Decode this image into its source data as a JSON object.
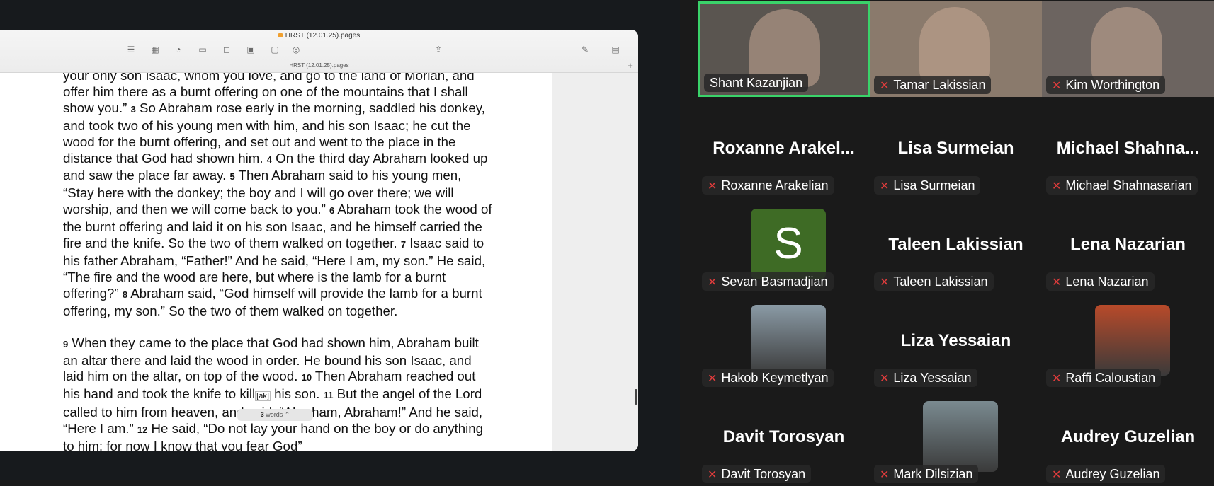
{
  "pages_window": {
    "title": "HRST (12.01.25).pages",
    "subtitle": "HRST (12.01.25).pages",
    "toolbar_icons": [
      "list-icon",
      "table-icon",
      "chart-icon",
      "text-icon",
      "shape-icon",
      "media-icon",
      "comment-icon",
      "collaborate-icon",
      "share-icon",
      "format-brush-icon",
      "document-icon"
    ],
    "word_count_number": "3",
    "word_count_label": " words ⌃",
    "document_paragraphs": [
      [
        {
          "t": "your only son Isaac, whom you love, and go to the land of Moriah, and offer him there as a burnt offering on one of the mountains that I shall show you.” "
        },
        {
          "v": "3"
        },
        {
          "t": " So Abraham rose early in the morning, saddled his donkey, and took two of his young men with him, and his son Isaac; he cut the wood for the burnt offering, and set out and went to the place in the distance that God had shown him. "
        },
        {
          "v": "4"
        },
        {
          "t": " On the third day Abraham looked up and saw the place far away. "
        },
        {
          "v": "5"
        },
        {
          "t": " Then Abraham said to his young men, “Stay here with the donkey; the boy and I will go over there; we will worship, and then we will come back to you.” "
        },
        {
          "v": "6"
        },
        {
          "t": " Abraham took the wood of the burnt offering and laid it on his son Isaac, and he himself carried the fire and the knife. So the two of them walked on together. "
        },
        {
          "v": "7"
        },
        {
          "t": " Isaac said to his father Abraham, “Father!” And he said, “Here I am, my son.” He said, “The fire and the wood are here, but where is the lamb for a burnt offering?” "
        },
        {
          "v": "8"
        },
        {
          "t": " Abraham said, “God himself will provide the lamb for a burnt offering, my son.” So the two of them walked on together."
        }
      ],
      [
        {
          "v": "9"
        },
        {
          "t": " When they came to the place that God had shown him, Abraham built an altar there and laid the wood in order. He bound his son Isaac, and laid him on the altar, on top of the wood. "
        },
        {
          "v": "10"
        },
        {
          "t": " Then Abraham reached out his hand and took the knife to kill"
        },
        {
          "f": "[ak]"
        },
        {
          "t": " his son. "
        },
        {
          "v": "11"
        },
        {
          "t": " But the angel of the Lord called to him from heaven, and said, “Abraham, Abraham!” And he said, “Here I am.” "
        },
        {
          "v": "12"
        },
        {
          "t": " He said, “Do not lay your hand on the boy or do anything to him; for now I know that you fear God”"
        }
      ]
    ]
  },
  "participants": [
    {
      "name": "Shant Kazanjian",
      "display": "Shant Kazanjian",
      "type": "video",
      "muted": false,
      "active": true,
      "bg": "#5a5550"
    },
    {
      "name": "Tamar Lakissian",
      "display": "Tamar Lakissian",
      "type": "video",
      "muted": true,
      "bg": "#8a7a6c"
    },
    {
      "name": "Kim Worthington",
      "display": "Kim Worthington",
      "type": "video",
      "muted": true,
      "bg": "#6c6460"
    },
    {
      "name": "Roxanne Arakelian",
      "display": "Roxanne  Arakel...",
      "type": "name",
      "muted": true
    },
    {
      "name": "Lisa Surmeian",
      "display": "Lisa Surmeian",
      "type": "name",
      "muted": true
    },
    {
      "name": "Michael Shahnasarian",
      "display": "Michael  Shahna...",
      "type": "name",
      "muted": true
    },
    {
      "name": "Sevan Basmadjian",
      "display": "S",
      "type": "letter",
      "muted": true,
      "bg": "#3e6b25"
    },
    {
      "name": "Taleen Lakissian",
      "display": "Taleen Lakissian",
      "type": "name",
      "muted": true
    },
    {
      "name": "Lena Nazarian",
      "display": "Lena Nazarian",
      "type": "name",
      "muted": true
    },
    {
      "name": "Hakob Keymetlyan",
      "display": "",
      "type": "photo",
      "muted": true,
      "bg": "#8a9aa5"
    },
    {
      "name": "Liza Yessaian",
      "display": "Liza Yessaian",
      "type": "name",
      "muted": true
    },
    {
      "name": "Raffi Caloustian",
      "display": "",
      "type": "photo",
      "muted": true,
      "bg": "#b84a2a"
    },
    {
      "name": "Davit Torosyan",
      "display": "Davit Torosyan",
      "type": "name",
      "muted": true
    },
    {
      "name": "Mark Dilsizian",
      "display": "",
      "type": "photo",
      "muted": true,
      "bg": "#7a8a90"
    },
    {
      "name": "Audrey Guzelian",
      "display": "Audrey Guzelian",
      "type": "name",
      "muted": true
    }
  ]
}
